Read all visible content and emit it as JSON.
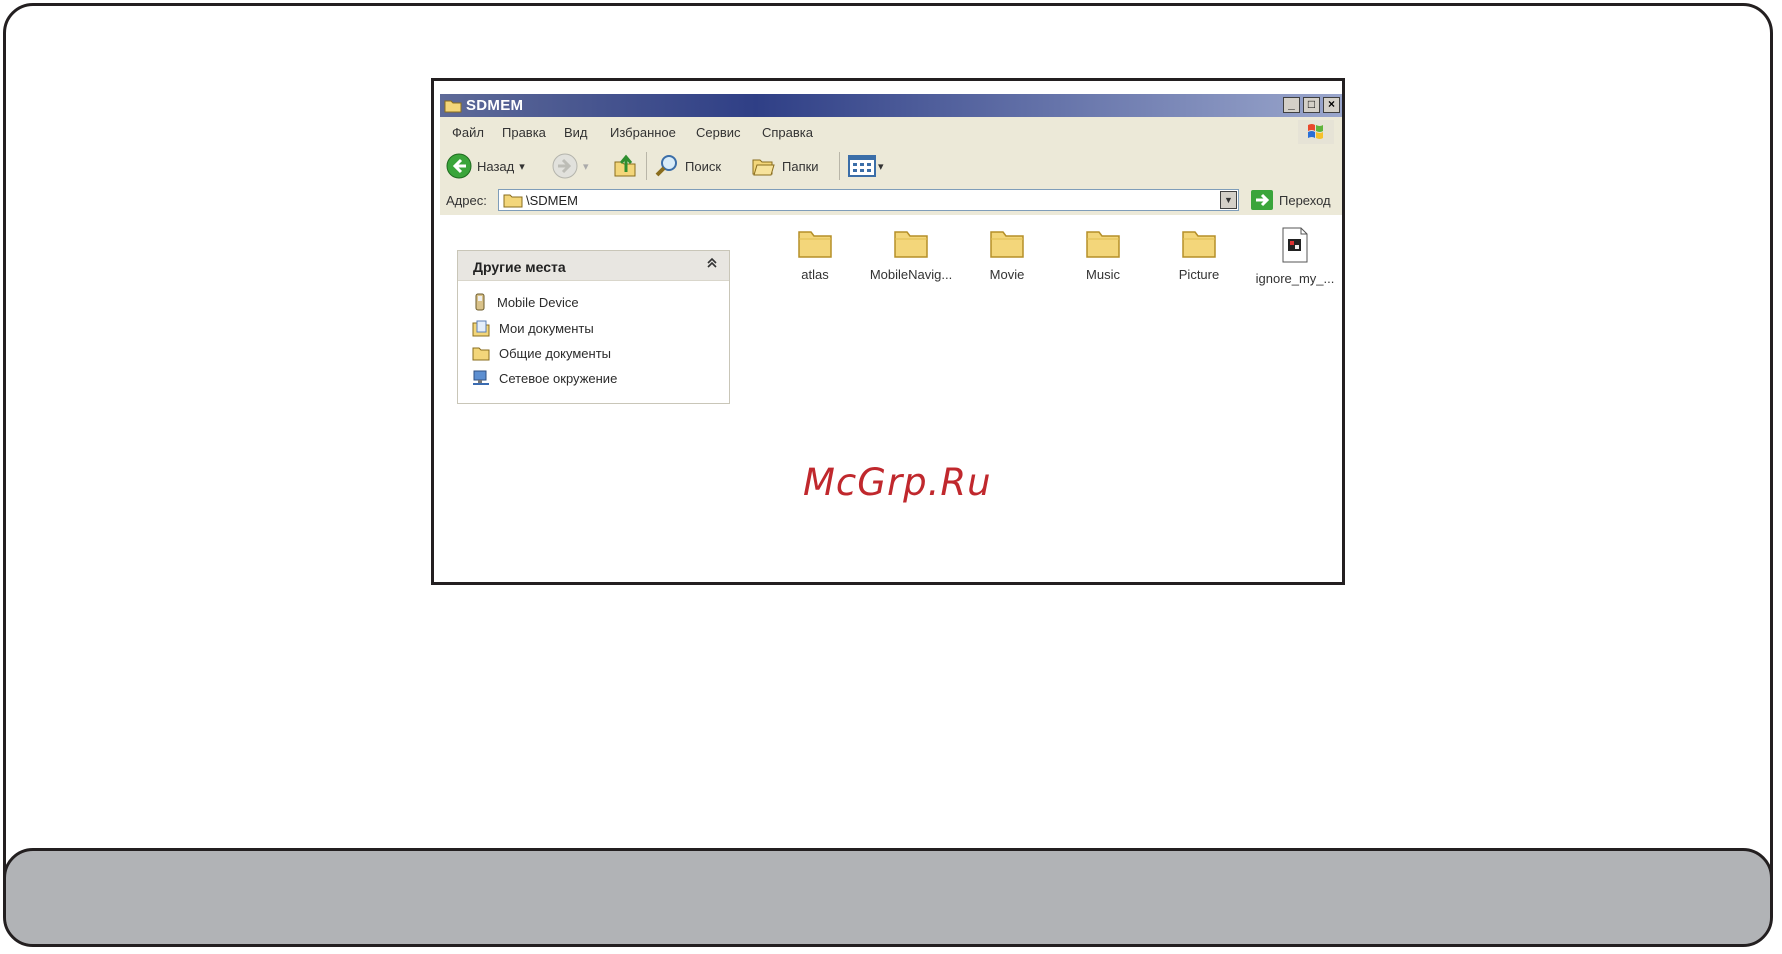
{
  "window": {
    "title": "SDMEM",
    "controls": {
      "minimize": "_",
      "maximize": "□",
      "close": "×"
    }
  },
  "menu": {
    "items": [
      "Файл",
      "Правка",
      "Вид",
      "Избранное",
      "Сервис",
      "Справка"
    ]
  },
  "toolbar": {
    "back_label": "Назад",
    "search_label": "Поиск",
    "folders_label": "Папки",
    "dropdown_arrow": "▾",
    "forward_arrow": "▾"
  },
  "address": {
    "label": "Адрес:",
    "value": "\\SDMEM",
    "go_label": "Переход",
    "dropdown_arrow": "▼"
  },
  "task_panel": {
    "title": "Другие места",
    "collapse_glyph": "«",
    "links": [
      {
        "label": "Mobile Device",
        "icon": "mobile-device-icon"
      },
      {
        "label": "Мои документы",
        "icon": "my-documents-icon"
      },
      {
        "label": "Общие документы",
        "icon": "shared-folder-icon"
      },
      {
        "label": "Сетевое окружение",
        "icon": "network-icon"
      }
    ]
  },
  "files": [
    {
      "name": "atlas",
      "type": "folder"
    },
    {
      "name": "MobileNavig...",
      "type": "folder"
    },
    {
      "name": "Movie",
      "type": "folder"
    },
    {
      "name": "Music",
      "type": "folder"
    },
    {
      "name": "Picture",
      "type": "folder"
    },
    {
      "name": "ignore_my_...",
      "type": "file"
    }
  ],
  "watermark": "McGrp.Ru",
  "colors": {
    "titlebar": "#2f3f86",
    "chrome": "#ece9d8",
    "folder": "#f3d67a",
    "watermark": "#c0282d",
    "footer_band": "#b1b3b6"
  }
}
